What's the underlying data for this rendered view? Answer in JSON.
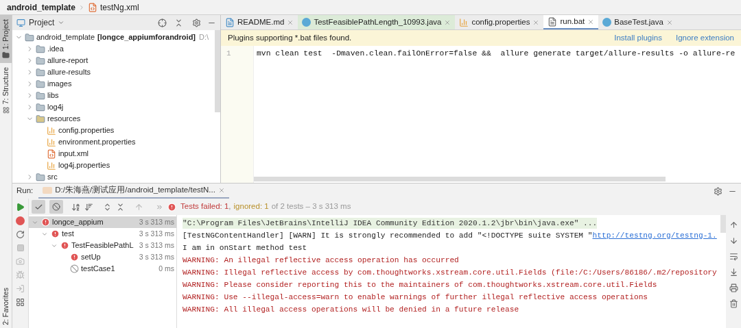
{
  "breadcrumb": [
    {
      "label": "android_template",
      "kind": "project"
    },
    {
      "label": "testNg.xml",
      "kind": "xml"
    }
  ],
  "left_stripe": [
    {
      "label": "1: Project",
      "selected": true,
      "kind": "project"
    },
    {
      "label": "7: Structure",
      "selected": false,
      "kind": "structure"
    }
  ],
  "bottom_stripe": [
    {
      "label": "2: Favorites",
      "selected": false
    }
  ],
  "project_panel": {
    "title": "Project",
    "tree": [
      {
        "label": "android_template",
        "module": "[longce_appiumforandroid]",
        "path": "D:\\",
        "kind": "module",
        "expanded": true,
        "children": [
          {
            "label": ".idea",
            "kind": "folder",
            "expanded": false
          },
          {
            "label": "allure-report",
            "kind": "folder",
            "expanded": false
          },
          {
            "label": "allure-results",
            "kind": "folder",
            "expanded": false
          },
          {
            "label": "images",
            "kind": "folder",
            "expanded": false
          },
          {
            "label": "libs",
            "kind": "folder",
            "expanded": false
          },
          {
            "label": "log4j",
            "kind": "folder",
            "expanded": false
          },
          {
            "label": "resources",
            "kind": "resources",
            "expanded": true,
            "children": [
              {
                "label": "config.properties",
                "kind": "properties"
              },
              {
                "label": "environment.properties",
                "kind": "properties"
              },
              {
                "label": "input.xml",
                "kind": "xml"
              },
              {
                "label": "log4j.properties",
                "kind": "properties"
              }
            ]
          },
          {
            "label": "src",
            "kind": "folder",
            "expanded": false
          }
        ]
      }
    ]
  },
  "editor": {
    "tabs": [
      {
        "label": "README.md",
        "kind": "md",
        "selected": false
      },
      {
        "label": "TestFeasiblePathLength_10993.java",
        "kind": "class",
        "selected": false
      },
      {
        "label": "config.properties",
        "kind": "properties",
        "selected": false
      },
      {
        "label": "run.bat",
        "kind": "text",
        "selected": true
      },
      {
        "label": "BaseTest.java",
        "kind": "class",
        "selected": false
      }
    ],
    "banner": {
      "text": "Plugins supporting *.bat files found.",
      "actions": [
        "Install plugins",
        "Ignore extension"
      ]
    },
    "lines": [
      {
        "number": "1",
        "code": "mvn clean test  -Dmaven.clean.failOnError=false &&  allure generate target/allure-results -o allure-re"
      }
    ]
  },
  "run_panel": {
    "label": "Run:",
    "tab": "D:/朱海燕/测试应用/android_template/testN...",
    "toggles": [
      {
        "kind": "passed",
        "on": true
      },
      {
        "kind": "ignored",
        "on": true
      }
    ],
    "status": {
      "failed": "Tests failed: 1",
      "separator": ",",
      "ignored": "ignored: 1",
      "rest": "of 2 tests – 3 s 313 ms"
    },
    "tests": [
      {
        "label": "longce_appium",
        "kind": "failed",
        "time": "3 s 313 ms",
        "selected": true,
        "expanded": true,
        "children": [
          {
            "label": "test",
            "kind": "failed",
            "time": "3 s 313 ms",
            "selected": false,
            "expanded": true,
            "children": [
              {
                "label": "TestFeasiblePathL",
                "kind": "failed",
                "time": "3 s 313 ms",
                "selected": false,
                "expanded": true,
                "children": [
                  {
                    "label": "setUp",
                    "kind": "failed",
                    "time": "3 s 313 ms",
                    "selected": false
                  },
                  {
                    "label": "testCase1",
                    "kind": "ignored",
                    "time": "0 ms",
                    "selected": false
                  }
                ]
              }
            ]
          }
        ]
      }
    ],
    "console": [
      {
        "kind": "command",
        "text": "\"C:\\Program Files\\JetBrains\\IntelliJ IDEA Community Edition 2020.1.2\\jbr\\bin\\java.exe\" ..."
      },
      {
        "kind": "info",
        "text": "[TestNGContentHandler] [WARN] It is strongly recommended to add \"<!DOCTYPE suite SYSTEM \"",
        "link": "http://testng.org/testng-1."
      },
      {
        "kind": "info",
        "text": "I am in onStart method test"
      },
      {
        "kind": "warning",
        "text": "WARNING: An illegal reflective access operation has occurred"
      },
      {
        "kind": "warning",
        "text": "WARNING: Illegal reflective access by com.thoughtworks.xstream.core.util.Fields (file:/C:/Users/86186/.m2/repository"
      },
      {
        "kind": "warning",
        "text": "WARNING: Please consider reporting this to the maintainers of com.thoughtworks.xstream.core.util.Fields"
      },
      {
        "kind": "warning",
        "text": "WARNING: Use --illegal-access=warn to enable warnings of further illegal reflective access operations"
      },
      {
        "kind": "warning",
        "text": "WARNING: All illegal access operations will be denied in a future release"
      }
    ]
  }
}
